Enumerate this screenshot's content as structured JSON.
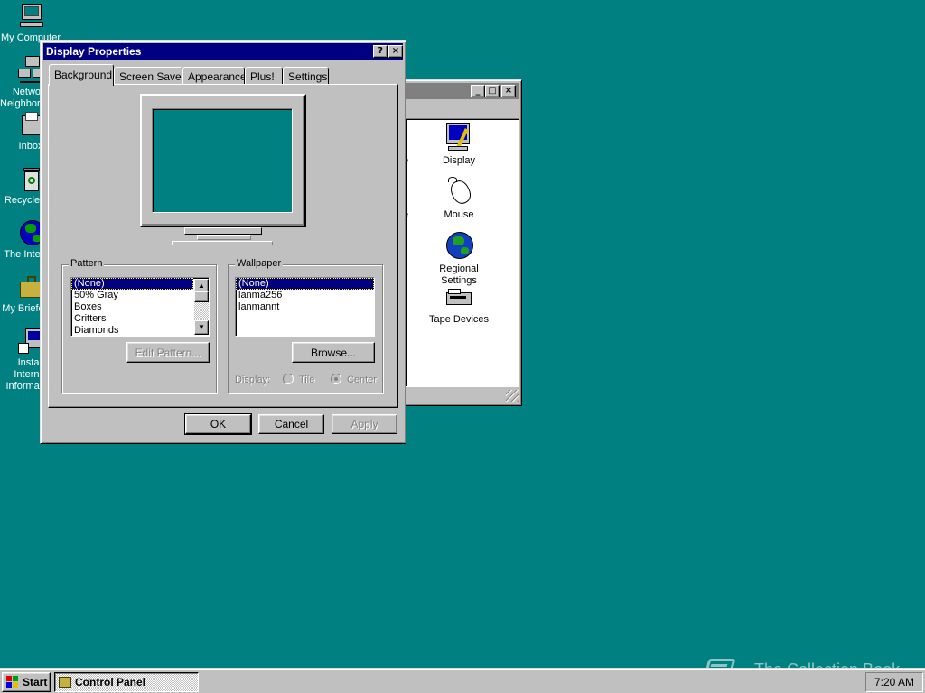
{
  "desktop": {
    "icons": [
      {
        "label": "My Computer"
      },
      {
        "label": "Network\nNeighborhood"
      },
      {
        "label": "Inbox"
      },
      {
        "label": "Recycle Bin"
      },
      {
        "label": "The Internet"
      },
      {
        "label": "My Briefcase"
      },
      {
        "label": "Install Internet\nInformation"
      }
    ]
  },
  "control_panel": {
    "items": [
      {
        "label": "Display",
        "icon": "display-icon"
      },
      {
        "label": "Mouse",
        "icon": "mouse-icon"
      },
      {
        "label": "Regional\nSettings",
        "icon": "globe-icon"
      },
      {
        "label": "Tape Devices",
        "icon": "tape-drive-icon"
      }
    ],
    "partial_left_labels": [
      "e",
      "e"
    ]
  },
  "display_properties": {
    "title": "Display Properties",
    "help_label": "?",
    "close_label": "×",
    "tabs": [
      {
        "label": "Background",
        "selected": true
      },
      {
        "label": "Screen Saver",
        "selected": false
      },
      {
        "label": "Appearance",
        "selected": false
      },
      {
        "label": "Plus!",
        "selected": false
      },
      {
        "label": "Settings",
        "selected": false
      }
    ],
    "pattern": {
      "legend": "Pattern",
      "items": [
        "(None)",
        "50% Gray",
        "Boxes",
        "Critters",
        "Diamonds"
      ],
      "selected": "(None)",
      "edit_button": "Edit Pattern..."
    },
    "wallpaper": {
      "legend": "Wallpaper",
      "items": [
        "(None)",
        "lanma256",
        "lanmannt"
      ],
      "selected": "(None)",
      "browse_button": "Browse...",
      "display_label": "Display:",
      "tile_label": "Tile",
      "center_label": "Center"
    },
    "buttons": {
      "ok": "OK",
      "cancel": "Cancel",
      "apply": "Apply"
    }
  },
  "taskbar": {
    "start_label": "Start",
    "task_label": "Control Panel",
    "clock": "7:20 AM"
  },
  "watermark": {
    "text": "The Collection Book"
  },
  "colors": {
    "desktop": "#008080",
    "title_active": "#000080",
    "title_inactive": "#808080",
    "face": "#c0c0c0"
  }
}
